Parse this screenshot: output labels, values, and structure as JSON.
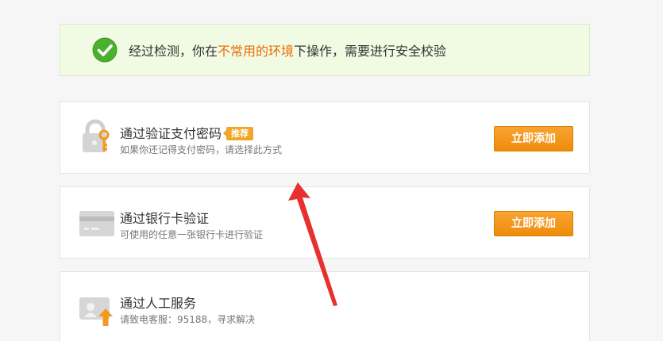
{
  "notice": {
    "text_before": "经过检测，你在",
    "text_highlight": "不常用的环境",
    "text_after": "下操作，需要进行安全校验",
    "check_color": "#4cb02f",
    "highlight_color": "#e96c00"
  },
  "options": [
    {
      "title": "通过验证支付密码",
      "badge": "推荐",
      "subtitle": "如果你还记得支付密码，请选择此方式",
      "button": "立即添加",
      "icon": "lock-key-icon"
    },
    {
      "title": "通过银行卡验证",
      "subtitle": "可使用的任意一张银行卡进行验证",
      "button": "立即添加",
      "icon": "bank-card-icon"
    },
    {
      "title": "通过人工服务",
      "subtitle": "请致电客服：95188，寻求解决",
      "icon": "id-card-upload-icon"
    }
  ],
  "annotation": {
    "arrow_color": "#e8312f"
  },
  "colors": {
    "button_orange": "#f39a1e",
    "badge_orange": "#f0a626",
    "notice_bg": "#f1fbe4"
  }
}
